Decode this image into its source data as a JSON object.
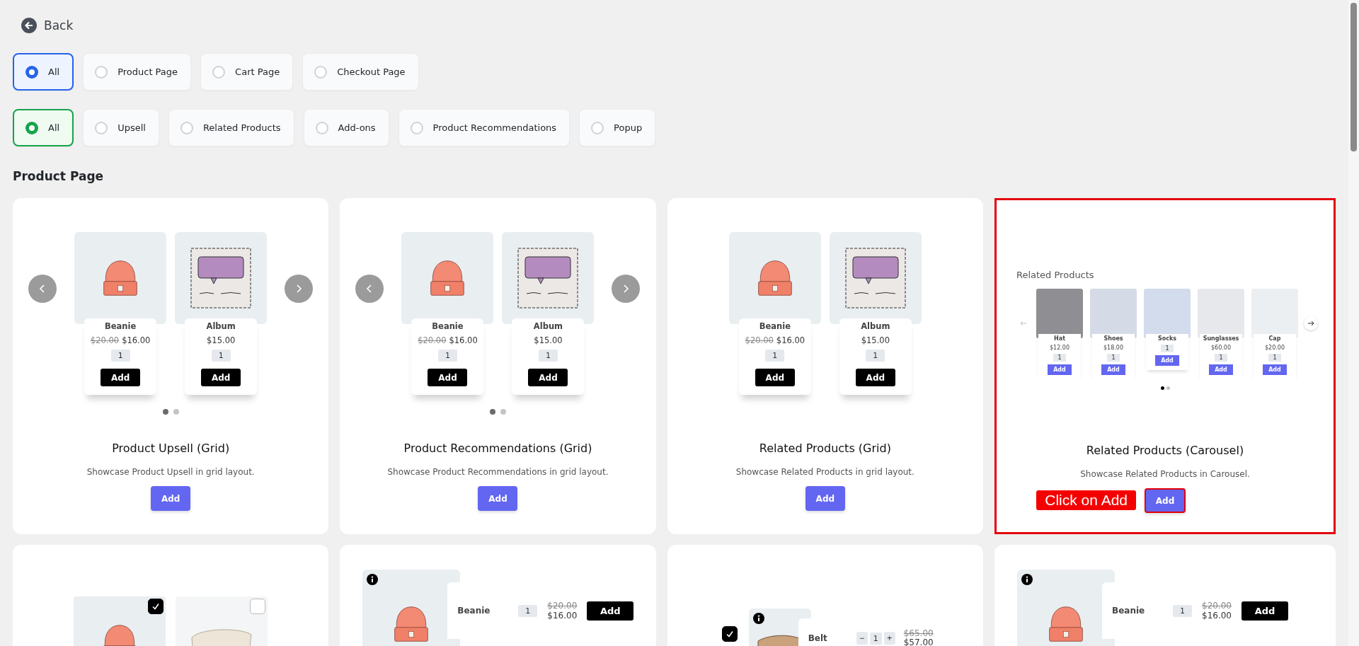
{
  "back_link": {
    "label": "Back"
  },
  "filter_groups": [
    {
      "options": [
        {
          "label": "All",
          "selected": true
        },
        {
          "label": "Product Page",
          "selected": false
        },
        {
          "label": "Cart Page",
          "selected": false
        },
        {
          "label": "Checkout Page",
          "selected": false
        }
      ]
    },
    {
      "options": [
        {
          "label": "All",
          "selected": true
        },
        {
          "label": "Upsell",
          "selected": false
        },
        {
          "label": "Related Products",
          "selected": false
        },
        {
          "label": "Add-ons",
          "selected": false
        },
        {
          "label": "Product Recommendations",
          "selected": false
        },
        {
          "label": "Popup",
          "selected": false
        }
      ]
    }
  ],
  "section_title": "Product Page",
  "cards": [
    {
      "kind": "grid",
      "title": "Product Upsell (Grid)",
      "description": "Showcase Product Upsell in grid layout.",
      "button": "Add",
      "highlighted": false,
      "preview": {
        "arrows": true,
        "products": [
          {
            "kind": "beanie",
            "name": "Beanie",
            "old_price": "$20.00",
            "price": "$16.00",
            "qty": "1",
            "button": "Add"
          },
          {
            "kind": "album",
            "name": "Album",
            "price": "$15.00",
            "qty": "1",
            "button": "Add"
          }
        ],
        "dots": [
          {
            "selected": true
          },
          {
            "selected": false
          }
        ]
      }
    },
    {
      "kind": "grid",
      "title": "Product Recommendations (Grid)",
      "description": "Showcase Product Recommendations in grid layout.",
      "button": "Add",
      "highlighted": false,
      "preview": {
        "arrows": true,
        "products": [
          {
            "kind": "beanie",
            "name": "Beanie",
            "old_price": "$20.00",
            "price": "$16.00",
            "qty": "1",
            "button": "Add"
          },
          {
            "kind": "album",
            "name": "Album",
            "price": "$15.00",
            "qty": "1",
            "button": "Add"
          }
        ],
        "dots": [
          {
            "selected": true
          },
          {
            "selected": false
          }
        ]
      }
    },
    {
      "kind": "grid",
      "title": "Related Products (Grid)",
      "description": "Showcase Related Products in grid layout.",
      "button": "Add",
      "highlighted": false,
      "preview": {
        "arrows": false,
        "products": [
          {
            "kind": "beanie",
            "name": "Beanie",
            "old_price": "$20.00",
            "price": "$16.00",
            "qty": "1",
            "button": "Add"
          },
          {
            "kind": "album",
            "name": "Album",
            "price": "$15.00",
            "qty": "1",
            "button": "Add"
          }
        ]
      }
    },
    {
      "kind": "carousel",
      "title": "Related Products (Carousel)",
      "description": "Showcase Related Products in Carousel.",
      "button": "Add",
      "highlighted": true,
      "callout": "Click on Add",
      "preview": {
        "heading": "Related Products",
        "products": [
          {
            "name": "Hat",
            "price": "$12.00",
            "qty": "1",
            "button": "Add"
          },
          {
            "name": "Shoes",
            "price": "$18.00",
            "qty": "1",
            "button": "Add"
          },
          {
            "name": "Socks",
            "qty": "1",
            "button": "Add"
          },
          {
            "name": "Sunglasses",
            "price": "$60.00",
            "qty": "1",
            "button": "Add"
          },
          {
            "name": "Cap",
            "price": "$20.00",
            "qty": "1",
            "button": "Add"
          }
        ],
        "dots": [
          {
            "selected": true
          },
          {
            "selected": false
          }
        ]
      }
    }
  ],
  "more_cards": [
    {
      "kind": "bundle",
      "items": [
        {
          "kind": "beanie",
          "checked": true
        },
        {
          "kind": "cloth",
          "checked": false
        }
      ]
    },
    {
      "kind": "row",
      "product": {
        "kind": "beanie",
        "name": "Beanie",
        "qty": "1",
        "old_price": "$20.00",
        "price": "$16.00",
        "button": "Add"
      }
    },
    {
      "kind": "select_row",
      "checked": true,
      "product": {
        "kind": "belt",
        "name": "Belt",
        "minus": "−",
        "qty": "1",
        "plus": "+",
        "old_price": "$65.00",
        "price": "$57.00"
      }
    },
    {
      "kind": "row",
      "product": {
        "kind": "beanie",
        "name": "Beanie",
        "qty": "1",
        "old_price": "$20.00",
        "price": "$16.00",
        "button": "Add"
      }
    }
  ]
}
